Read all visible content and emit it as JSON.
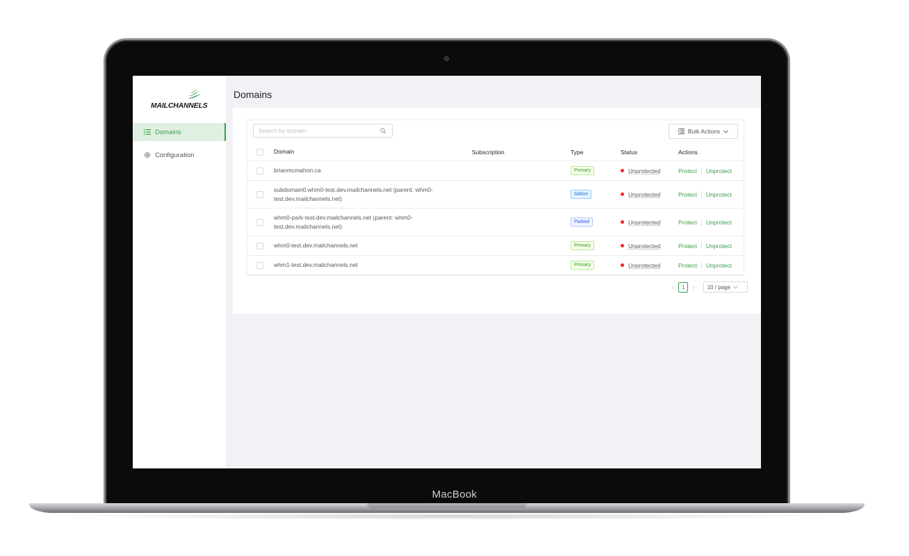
{
  "device": {
    "label": "MacBook"
  },
  "brand": {
    "logo_text": "MAILCHANNELS",
    "accent": "#3a9b48"
  },
  "sidebar": {
    "items": [
      {
        "label": "Domains",
        "icon": "list-icon",
        "active": true
      },
      {
        "label": "Configuration",
        "icon": "gear-icon",
        "active": false
      }
    ]
  },
  "page": {
    "title": "Domains"
  },
  "toolbar": {
    "search_placeholder": "Search by domain",
    "bulk_actions_label": "Bulk Actions"
  },
  "table": {
    "columns": {
      "domain": "Domain",
      "subscription": "Subscription",
      "type": "Type",
      "status": "Status",
      "actions": "Actions"
    },
    "rows": [
      {
        "domain": "brianmcmahon.ca",
        "subscription": "",
        "type": "Primary",
        "status": "Unprotected",
        "protect": "Protect",
        "unprotect": "Unprotect"
      },
      {
        "domain": "subdomain0.whm0-test.dev.mailchannels.net (parent: whm0-test.dev.mailchannels.net)",
        "subscription": "",
        "type": "Addon",
        "status": "Unprotected",
        "protect": "Protect",
        "unprotect": "Unprotect"
      },
      {
        "domain": "whm0-park-test.dev.mailchannels.net (parent: whm0-test.dev.mailchannels.net)",
        "subscription": "",
        "type": "Parked",
        "status": "Unprotected",
        "protect": "Protect",
        "unprotect": "Unprotect"
      },
      {
        "domain": "whm0-test.dev.mailchannels.net",
        "subscription": "",
        "type": "Primary",
        "status": "Unprotected",
        "protect": "Protect",
        "unprotect": "Unprotect"
      },
      {
        "domain": "whm1-test.dev.mailchannels.net",
        "subscription": "",
        "type": "Primary",
        "status": "Unprotected",
        "protect": "Protect",
        "unprotect": "Unprotect"
      }
    ]
  },
  "pagination": {
    "current_page": "1",
    "page_size": "10 / page"
  }
}
